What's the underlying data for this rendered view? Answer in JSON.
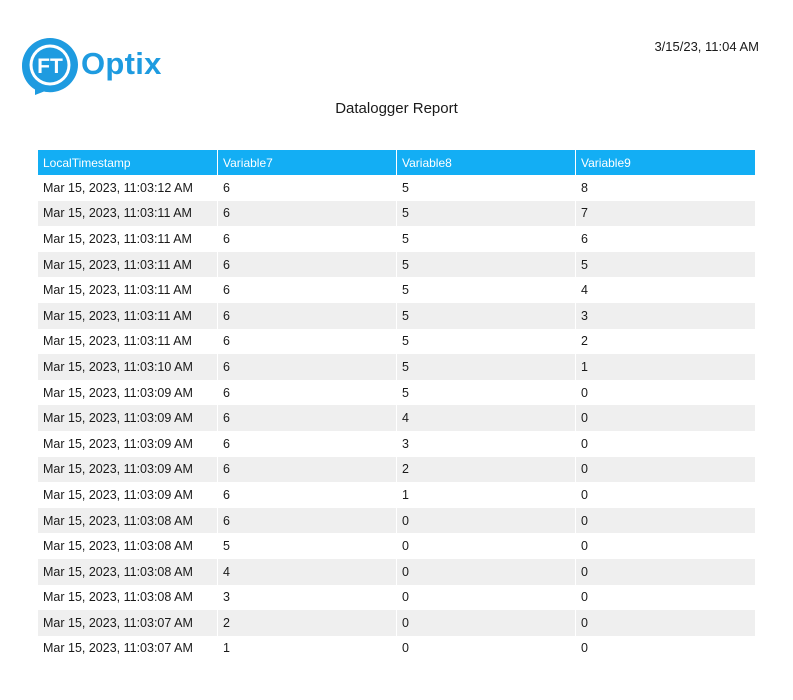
{
  "header": {
    "logo_mark": "FT",
    "logo_word": "Optix",
    "timestamp": "3/15/23, 11:04 AM",
    "title": "Datalogger Report"
  },
  "colors": {
    "brand": "#1e9be0",
    "table_header": "#13aef4",
    "row_stripe": "#efefef"
  },
  "table": {
    "columns": [
      "LocalTimestamp",
      "Variable7",
      "Variable8",
      "Variable9"
    ],
    "rows": [
      [
        "Mar 15, 2023, 11:03:12 AM",
        "6",
        "5",
        "8"
      ],
      [
        "Mar 15, 2023, 11:03:11 AM",
        "6",
        "5",
        "7"
      ],
      [
        "Mar 15, 2023, 11:03:11 AM",
        "6",
        "5",
        "6"
      ],
      [
        "Mar 15, 2023, 11:03:11 AM",
        "6",
        "5",
        "5"
      ],
      [
        "Mar 15, 2023, 11:03:11 AM",
        "6",
        "5",
        "4"
      ],
      [
        "Mar 15, 2023, 11:03:11 AM",
        "6",
        "5",
        "3"
      ],
      [
        "Mar 15, 2023, 11:03:11 AM",
        "6",
        "5",
        "2"
      ],
      [
        "Mar 15, 2023, 11:03:10 AM",
        "6",
        "5",
        "1"
      ],
      [
        "Mar 15, 2023, 11:03:09 AM",
        "6",
        "5",
        "0"
      ],
      [
        "Mar 15, 2023, 11:03:09 AM",
        "6",
        "4",
        "0"
      ],
      [
        "Mar 15, 2023, 11:03:09 AM",
        "6",
        "3",
        "0"
      ],
      [
        "Mar 15, 2023, 11:03:09 AM",
        "6",
        "2",
        "0"
      ],
      [
        "Mar 15, 2023, 11:03:09 AM",
        "6",
        "1",
        "0"
      ],
      [
        "Mar 15, 2023, 11:03:08 AM",
        "6",
        "0",
        "0"
      ],
      [
        "Mar 15, 2023, 11:03:08 AM",
        "5",
        "0",
        "0"
      ],
      [
        "Mar 15, 2023, 11:03:08 AM",
        "4",
        "0",
        "0"
      ],
      [
        "Mar 15, 2023, 11:03:08 AM",
        "3",
        "0",
        "0"
      ],
      [
        "Mar 15, 2023, 11:03:07 AM",
        "2",
        "0",
        "0"
      ],
      [
        "Mar 15, 2023, 11:03:07 AM",
        "1",
        "0",
        "0"
      ]
    ]
  }
}
